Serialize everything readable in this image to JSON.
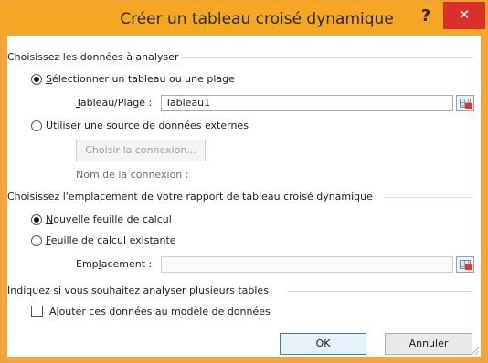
{
  "dialog": {
    "title": "Créer un tableau croisé dynamique",
    "help_label": "?",
    "close_label": "✕",
    "accent_color": "#f5a623"
  },
  "section_data": {
    "heading": "Choisissez les données à analyser",
    "option_table": {
      "prefix": "S",
      "rest": "électionner un tableau ou une plage",
      "selected": true
    },
    "table_range": {
      "prefix": "T",
      "rest": "ableau/Plage :",
      "value": "Tableau1"
    },
    "option_external": {
      "prefix": "U",
      "rest": "tiliser une source de données externes",
      "selected": false
    },
    "choose_connection_label": "Choisir la connexion...",
    "connection_name_label": "Nom de la connexion :"
  },
  "section_location": {
    "heading": "Choisissez l'emplacement de votre rapport de tableau croisé dynamique",
    "option_new_sheet": {
      "prefix": "N",
      "rest": "ouvelle feuille de calcul",
      "selected": true
    },
    "option_existing_sheet": {
      "prefix": "F",
      "rest": "euille de calcul existante",
      "selected": false
    },
    "location": {
      "before": "Emp",
      "underline": "l",
      "after": "acement :",
      "value": ""
    }
  },
  "section_tables": {
    "heading": "Indiquez si vous souhaitez analyser plusieurs tables",
    "checkbox": {
      "before": "Ajouter ces données au ",
      "underline": "m",
      "after": "odèle de données",
      "checked": false
    }
  },
  "buttons": {
    "ok_label": "OK",
    "cancel_label": "Annuler"
  }
}
